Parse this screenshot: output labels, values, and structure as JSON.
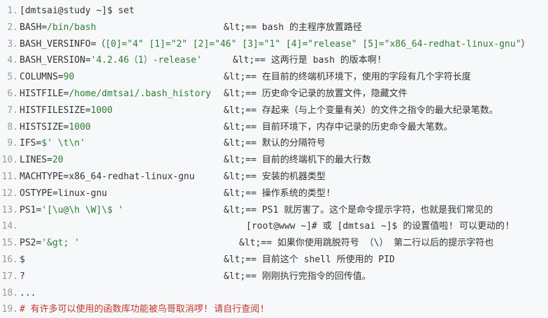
{
  "lines": [
    {
      "num": "1.",
      "code": [
        {
          "t": "[dmtsai@study ~]$ set",
          "c": "blk"
        }
      ],
      "comment": ""
    },
    {
      "num": "2.",
      "code": [
        {
          "t": "BASH=",
          "c": "blk"
        },
        {
          "t": "/bin/bash",
          "c": "green"
        }
      ],
      "comment": "&lt;== bash 的主程序放置路径"
    },
    {
      "num": "3.",
      "code": [
        {
          "t": "BASH_VERSINFO=（",
          "c": "blk"
        },
        {
          "t": "[0]=\"4\" [1]=\"2\" [2]=\"46\" [3]=\"1\" [4]=\"release\" [5]=\"x86_64-redhat-linux-gnu\"",
          "c": "green"
        },
        {
          "t": "）",
          "c": "blk"
        }
      ],
      "comment": ""
    },
    {
      "num": "4.",
      "code": [
        {
          "t": "BASH_VERSION=",
          "c": "blk"
        },
        {
          "t": "'4.2.46（1）-release'",
          "c": "green"
        }
      ],
      "comment": "&lt;== 这两行是 bash 的版本啊!"
    },
    {
      "num": "5.",
      "code": [
        {
          "t": "COLUMNS=",
          "c": "blk"
        },
        {
          "t": "90",
          "c": "green"
        }
      ],
      "comment": "&lt;== 在目前的终端机环境下，使用的字段有几个字符长度"
    },
    {
      "num": "6.",
      "code": [
        {
          "t": "HISTFILE=",
          "c": "blk"
        },
        {
          "t": "/home/dmtsai/.bash_history",
          "c": "green"
        }
      ],
      "comment": "&lt;== 历史命令记录的放置文件，隐藏文件"
    },
    {
      "num": "7.",
      "code": [
        {
          "t": "HISTFILESIZE=",
          "c": "blk"
        },
        {
          "t": "1000",
          "c": "green"
        }
      ],
      "comment": "&lt;== 存起来（与上个变量有关）的文件之指令的最大纪录笔数。"
    },
    {
      "num": "8.",
      "code": [
        {
          "t": "HISTSIZE=",
          "c": "blk"
        },
        {
          "t": "1000",
          "c": "green"
        }
      ],
      "comment": "&lt;== 目前环境下，内存中记录的历史命令最大笔数。"
    },
    {
      "num": "9.",
      "code": [
        {
          "t": "IFS=",
          "c": "blk"
        },
        {
          "t": "$' \\t\\n'",
          "c": "green"
        }
      ],
      "comment": "&lt;== 默认的分隔符号"
    },
    {
      "num": "10.",
      "code": [
        {
          "t": "LINES=",
          "c": "blk"
        },
        {
          "t": "20",
          "c": "green"
        }
      ],
      "comment": "&lt;== 目前的终端机下的最大行数"
    },
    {
      "num": "11.",
      "code": [
        {
          "t": "MACHTYPE=x86_64-redhat-linux-gnu",
          "c": "blk"
        }
      ],
      "comment": "&lt;== 安装的机器类型"
    },
    {
      "num": "12.",
      "code": [
        {
          "t": "OSTYPE=linux-gnu",
          "c": "blk"
        }
      ],
      "comment": "&lt;== 操作系统的类型!"
    },
    {
      "num": "13.",
      "code": [
        {
          "t": "PS1=",
          "c": "blk"
        },
        {
          "t": "'[\\u@\\h \\W]\\$ '",
          "c": "green"
        }
      ],
      "comment": "&lt;== PS1 就厉害了。这个是命令提示字符，也就是我们常见的"
    },
    {
      "num": "14.",
      "code": [],
      "comment": "[root@www ~]# 或 [dmtsai ~]$ 的设置值啦! 可以更动的!"
    },
    {
      "num": "15.",
      "code": [
        {
          "t": "PS2=",
          "c": "blk"
        },
        {
          "t": "'&gt; '",
          "c": "green"
        }
      ],
      "comment": "&lt;== 如果你使用跳脱符号 （\\） 第二行以后的提示字符也"
    },
    {
      "num": "16.",
      "code": [
        {
          "t": "$",
          "c": "blk"
        }
      ],
      "comment": "&lt;== 目前这个 shell 所使用的 PID"
    },
    {
      "num": "17.",
      "code": [
        {
          "t": "?",
          "c": "blk"
        }
      ],
      "comment": "&lt;== 刚刚执行完指令的回传值。"
    },
    {
      "num": "18.",
      "code": [
        {
          "t": "...",
          "c": "blk"
        }
      ],
      "comment": ""
    },
    {
      "num": "19.",
      "code": [
        {
          "t": "# 有许多可以使用的函数库功能被鸟哥取消啰! 请自行查阅!",
          "c": "red"
        }
      ],
      "comment": ""
    }
  ],
  "colors": {
    "background": "#f6f8fa",
    "line_number": "#999999",
    "string": "#2e7d32",
    "comment_hash": "#c0392b",
    "text": "#333333"
  }
}
